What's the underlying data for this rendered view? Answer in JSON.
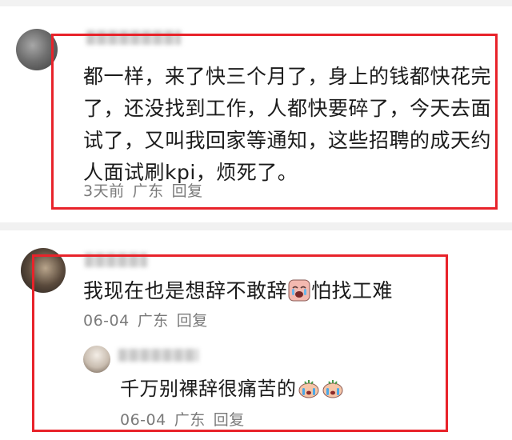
{
  "comments": [
    {
      "text": "都一样，来了快三个月了，身上的钱都快花完了，还没找到工作，人都快要碎了，今天去面试了，又叫我回家等通知，这些招聘的成天约人面试刷kpi，烦死了。",
      "time": "3天前",
      "location": "广东",
      "reply_label": "回复"
    },
    {
      "text_before": "我现在也是想辞不敢辞",
      "text_after": "怕找工难",
      "emoji": "crying-face-icon",
      "time": "06-04",
      "location": "广东",
      "reply_label": "回复",
      "replies": [
        {
          "text": "千万别裸辞很痛苦的",
          "emoji": "crying-face-icon",
          "time": "06-04",
          "location": "广东",
          "reply_label": "回复"
        }
      ]
    }
  ],
  "colors": {
    "highlight": "#e8232a",
    "meta_text": "#7a7a7a",
    "body_text": "#1b1b1b"
  }
}
